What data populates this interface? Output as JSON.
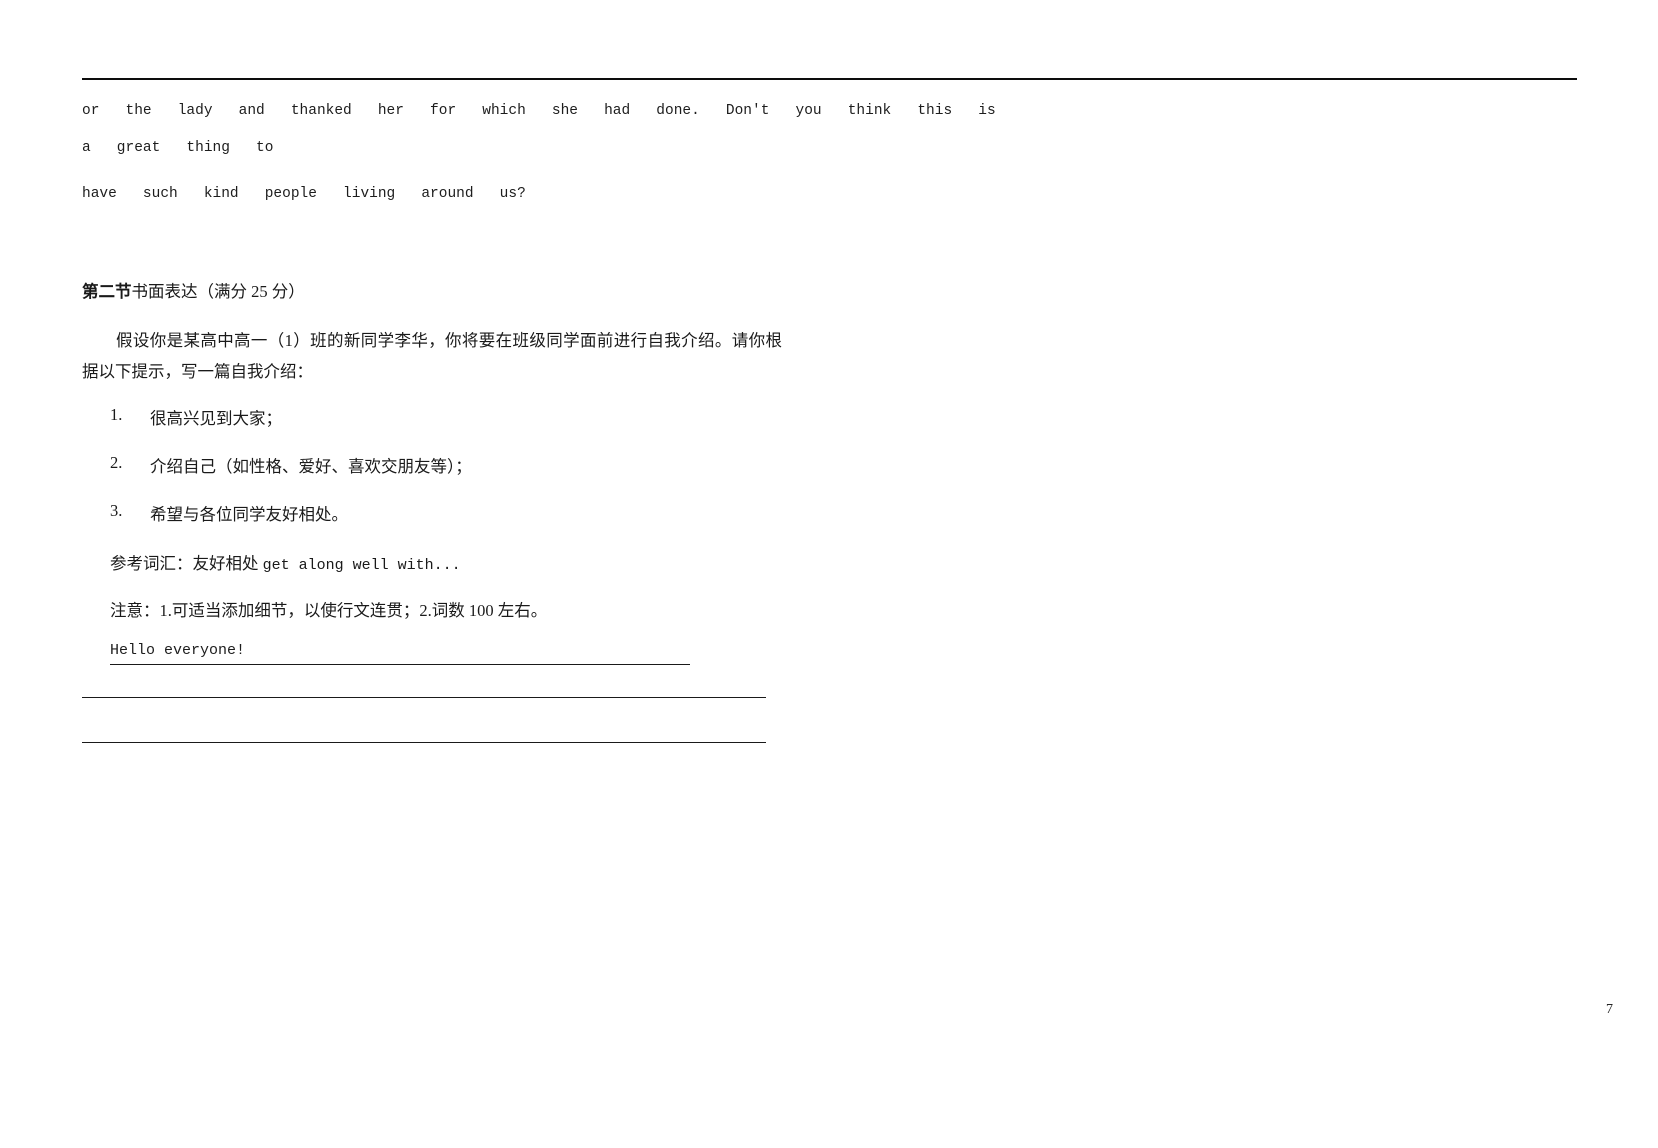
{
  "document": {
    "page_number": "7"
  },
  "passage": {
    "lines": [
      "or   the   lady   and   thanked   her   for   which   she   had   done.   Don't   you   think   this   is",
      "a   great   thing   to",
      "have   such   kind   people   living   around   us?"
    ]
  },
  "section": {
    "number": "第二节",
    "title": "书面表达（满分 25 分）"
  },
  "prompt": {
    "text": "假设你是某高中高一（1）班的新同学李华，你将要在班级同学面前进行自我介绍。请你根据以下提示，写一篇自我介绍："
  },
  "requirements": [
    {
      "num": "1.",
      "text": "很高兴见到大家；"
    },
    {
      "num": "2.",
      "text": "介绍自己（如性格、爱好、喜欢交朋友等）；"
    },
    {
      "num": "3.",
      "text": "希望与各位同学友好相处。"
    }
  ],
  "vocabulary": {
    "label": "参考词汇：友好相处 ",
    "english": "get along well with..."
  },
  "attention": {
    "text": "注意：1.可适当添加细节，以使行文连贯；2.词数 100 左右。"
  },
  "answer": {
    "opening": "Hello everyone!"
  }
}
